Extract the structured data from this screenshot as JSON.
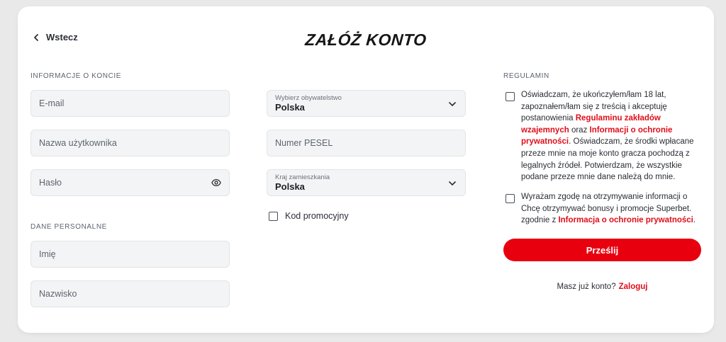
{
  "header": {
    "back_label": "Wstecz",
    "title": "ZAŁÓŻ KONTO"
  },
  "sections": {
    "account": "INFORMACJE O KONCIE",
    "personal": "DANE PERSONALNE",
    "terms": "REGULAMIN"
  },
  "fields": {
    "email": "E-mail",
    "username": "Nazwa użytkownika",
    "password": "Hasło",
    "first_name": "Imię",
    "last_name": "Nazwisko",
    "pesel": "Numer PESEL"
  },
  "selects": {
    "citizenship": {
      "label": "Wybierz obywatelstwo",
      "value": "Polska"
    },
    "residence": {
      "label": "Kraj zamieszkania",
      "value": "Polska"
    }
  },
  "promo": {
    "label": "Kod promocyjny"
  },
  "consent1": {
    "p1": "Oświadczam, że ukończyłem/łam 18 lat,",
    "p2": "zapoznałem/łam się z treścią i akceptuję",
    "p3": "postanowienia ",
    "link1": "Regulaminu zakładów wzajemnych",
    "p4": " oraz ",
    "link2": "Informacji o ochronie prywatności",
    "p5": ". Oświadczam, że środki wpłacane przeze mnie na moje konto gracza pochodzą z legalnych źródeł. Potwierdzam, że wszystkie podane przeze mnie dane należą do mnie."
  },
  "consent2": {
    "p1": "Wyrażam zgodę na otrzymywanie informacji o Chcę otrzymywać bonusy i promocje Superbet. zgodnie z ",
    "link": "Informacja o ochronie prywatności",
    "p2": "."
  },
  "submit_label": "Prześlij",
  "login": {
    "question": "Masz już konto?",
    "link": "Zaloguj"
  },
  "colors": {
    "accent": "#e8000f",
    "link": "#e00e1a",
    "field_bg": "#f3f4f5"
  }
}
